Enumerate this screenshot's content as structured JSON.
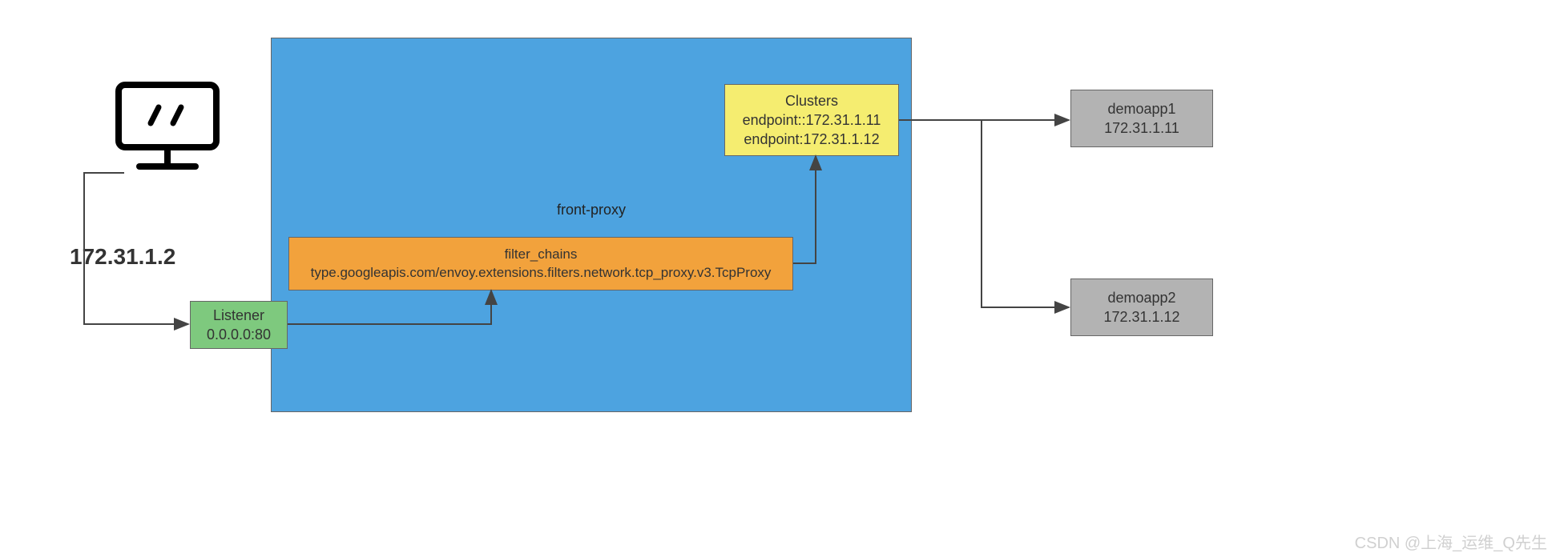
{
  "client_ip": "172.31.1.2",
  "front_proxy": {
    "label": "front-proxy"
  },
  "listener": {
    "title": "Listener",
    "addr": "0.0.0.0:80"
  },
  "filter_chains": {
    "title": "filter_chains",
    "type": "type.googleapis.com/envoy.extensions.filters.network.tcp_proxy.v3.TcpProxy"
  },
  "clusters": {
    "title": "Clusters",
    "endpoint1": "endpoint::172.31.1.11",
    "endpoint2": "endpoint:172.31.1.12"
  },
  "demoapp1": {
    "name": "demoapp1",
    "ip": "172.31.1.11"
  },
  "demoapp2": {
    "name": "demoapp2",
    "ip": "172.31.1.12"
  },
  "watermark": "CSDN @上海_运维_Q先生"
}
